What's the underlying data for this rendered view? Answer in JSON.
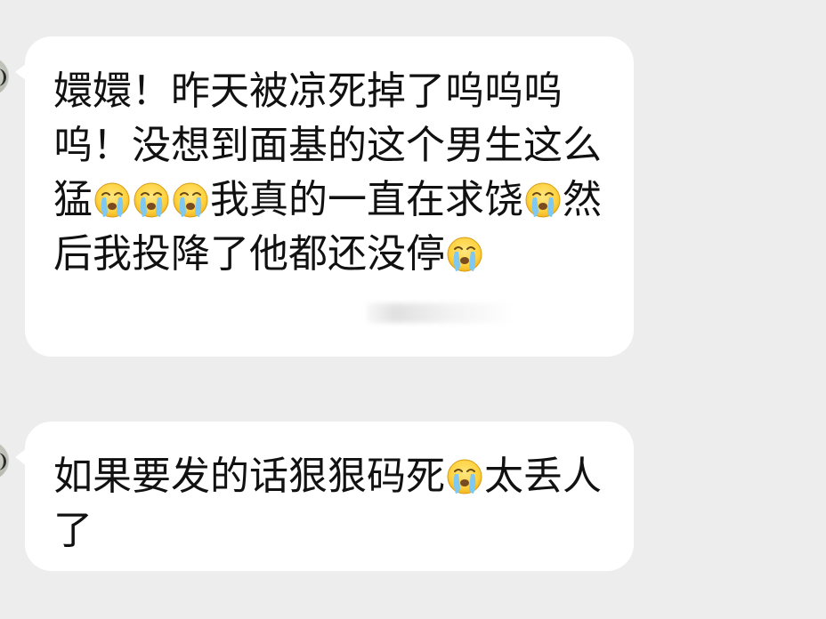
{
  "messages": [
    {
      "text_parts": [
        "嬛嬛！昨天被凉死掉了呜呜呜呜！没想到面基的这个男生这么猛",
        "我真的一直在求饶",
        "然后我投降了他都还没停",
        ""
      ],
      "emoji_groups": [
        3,
        1,
        1
      ]
    },
    {
      "text_parts": [
        "如果要发的话狠狠码死",
        "太丢人了"
      ],
      "emoji_groups": [
        1
      ]
    }
  ],
  "icons": {
    "emoji": "loudly-crying-face-emoji"
  },
  "colors": {
    "background": "#ededed",
    "bubble": "#ffffff",
    "text": "#111111"
  }
}
